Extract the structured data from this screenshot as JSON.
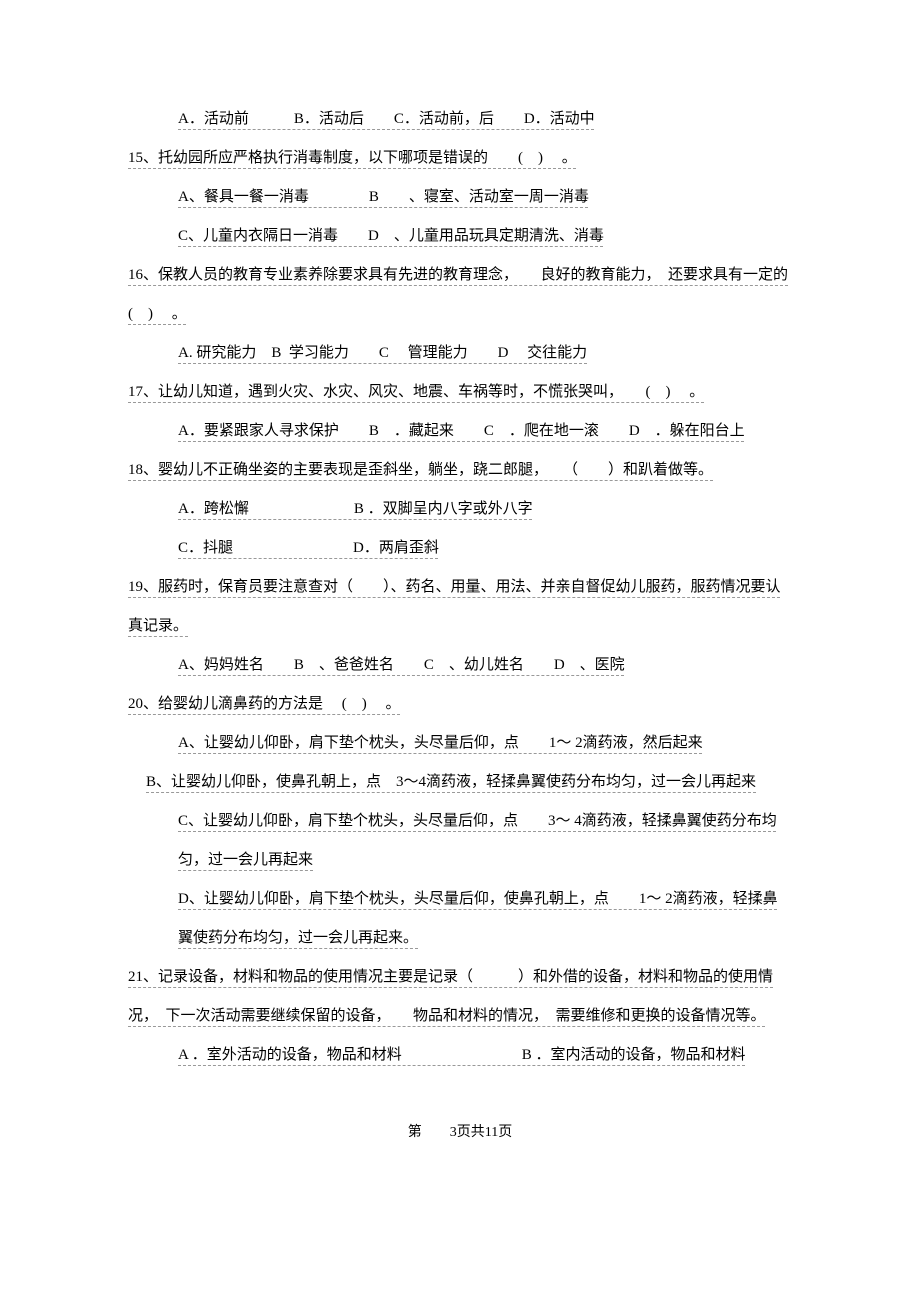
{
  "q14_options": "A．活动前　　　B．活动后　　C．活动前，后　　D．活动中",
  "q15_text": "15、托幼园所应严格执行消毒制度，以下哪项是错误的　　(　) 　。",
  "q15_opt1": "A、餐具一餐一消毒　　　　B　　、寝室、活动室一周一消毒",
  "q15_opt2": "C、儿童内衣隔日一消毒　　D　、儿童用品玩具定期清洗、消毒",
  "q16_text": "16、保教人员的教育专业素养除要求具有先进的教育理念，　　良好的教育能力，　还要求具有一定的(　) 　。",
  "q16_opt": "A. 研究能力　B  学习能力　　C　 管理能力　　D　 交往能力",
  "q17_text": "17、让幼儿知道，遇到火灾、水灾、风灾、地震、车祸等时，不慌张哭叫，　　(　) 　。",
  "q17_opt": "A．要紧跟家人寻求保护　　B　．藏起来　　C　．爬在地一滚　　D　．躲在阳台上",
  "q18_text": "18、婴幼儿不正确坐姿的主要表现是歪斜坐，躺坐，跷二郎腿，　　（　　）和趴着做等。",
  "q18_opt1": "A．跨松懈　　　　　　　B ．双脚呈内八字或外八字",
  "q18_opt2": "C．抖腿　　　　　　　　D．两肩歪斜",
  "q19_text": "19、服药时，保育员要注意查对（　　）、药名、用量、用法、并亲自督促幼儿服药，服药情况要认真记录。",
  "q19_opt": "A、妈妈姓名　　B　、爸爸姓名　　C　、幼儿姓名　　D　、医院",
  "q20_text": "20、给婴幼儿滴鼻药的方法是　 (　) 　。",
  "q20_opt_a": "A、让婴幼儿仰卧，肩下垫个枕头，头尽量后仰，点　　1～ 2滴药液，然后起来",
  "q20_opt_b": "B、让婴幼儿仰卧，使鼻孔朝上，点　3～4滴药液，轻揉鼻翼使药分布均匀，过一会儿再起来",
  "q20_opt_c": "C、让婴幼儿仰卧，肩下垫个枕头，头尽量后仰，点　　3～ 4滴药液，轻揉鼻翼使药分布均匀，过一会儿再起来",
  "q20_opt_d": "D、让婴幼儿仰卧，肩下垫个枕头，头尽量后仰，使鼻孔朝上，点　　1～ 2滴药液，轻揉鼻翼使药分布均匀，过一会儿再起来。",
  "q21_text": "21、记录设备，材料和物品的使用情况主要是记录（　　　）和外借的设备，材料和物品的使用情况，　下一次活动需要继续保留的设备，　　物品和材料的情况，　需要维修和更换的设备情况等。",
  "q21_opt": "A ．室外活动的设备，物品和材料　　　　　　　　B ．室内活动的设备，物品和材料",
  "footer": "第　　3页共11页"
}
